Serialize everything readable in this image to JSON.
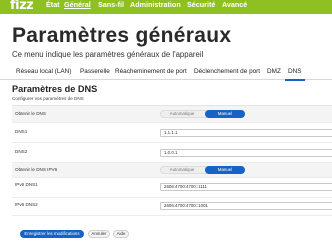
{
  "brand": {
    "logo": "fizz",
    "color": "#8fc021"
  },
  "nav": [
    "État",
    "Général",
    "Sans-fil",
    "Administration",
    "Sécurité",
    "Avancé"
  ],
  "nav_active": "Général",
  "page": {
    "title": "Paramètres généraux",
    "description": "Ce menu indique les paramètres généraux de l'appareil"
  },
  "tabs": [
    "Réseau local (LAN)",
    "Passerelle",
    "Réacheminement de port",
    "Déclenchement de port",
    "DMZ",
    "DNS"
  ],
  "tab_active": "DNS",
  "section": {
    "title": "Paramètres de DNS",
    "description": "Configurer vos paramètres de DNS"
  },
  "form": {
    "obtain_dns": {
      "label": "Obtenir le DNS",
      "options": [
        "Automatique",
        "Manuel"
      ],
      "selected": "Manuel"
    },
    "dns1": {
      "label": "DNS1",
      "value": "1.1.1.1"
    },
    "dns2": {
      "label": "DNS2",
      "value": "1.0.0.1"
    },
    "obtain_ipv6": {
      "label": "Obtenir le DNS IPV6",
      "options": [
        "Automatique",
        "Manuel"
      ],
      "selected": "Manuel"
    },
    "ipv6_dns1": {
      "label": "IPv6 DNS1",
      "value": "2606:4700:4700::1111"
    },
    "ipv6_dns2": {
      "label": "IPv6 DNS2",
      "value": "2606:4700:4700::1001"
    }
  },
  "buttons": {
    "save": "Enregistrer les modifications",
    "cancel": "Annuler",
    "help": "Aide"
  },
  "accent": "#1762c6"
}
